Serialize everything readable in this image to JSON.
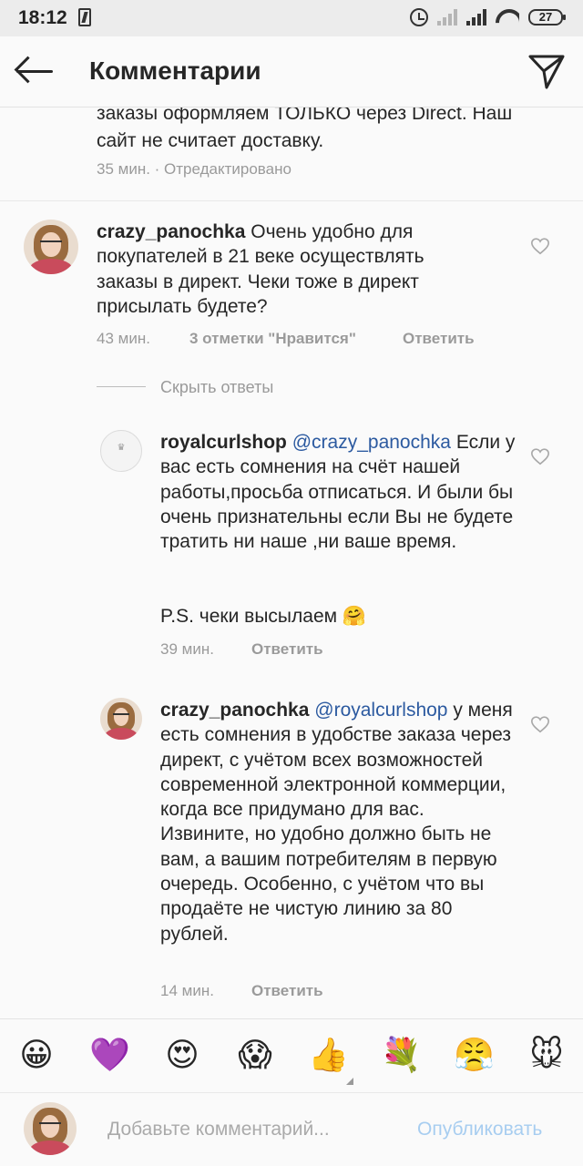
{
  "status": {
    "time": "18:12",
    "battery": "27"
  },
  "header": {
    "title": "Комментарии"
  },
  "previous": {
    "text": "заказы оформляем ТОЛЬКО через Direct. Наш сайт не считает доставку.",
    "meta": "35 мин. · Отредактировано"
  },
  "comments": [
    {
      "username": "crazy_panochka",
      "text": "Очень удобно для покупателей в 21 веке осуществлять заказы в директ. Чеки тоже в директ присылать будете?",
      "time": "43 мин.",
      "likes": "3 отметки \"Нравится\"",
      "reply_label": "Ответить"
    }
  ],
  "replies_toggle": "Скрыть ответы",
  "replies": [
    {
      "username": "royalcurlshop",
      "mention": "@crazy_panochka",
      "text": "Если у вас есть сомнения на счёт нашей работы,просьба отписаться.  И были бы очень признательны если Вы не будете тратить ни наше ,ни ваше время.",
      "ps": "P.S. чеки высылаем 🤗",
      "time": "39 мин.",
      "reply_label": "Ответить",
      "avatar_text": "ROYAL CURL SHOP"
    },
    {
      "username": "crazy_panochka",
      "mention": "@royalcurlshop",
      "text": "у меня есть сомнения в удобстве заказа через директ, с учётом всех возможностей современной электронной коммерции, когда все придумано для вас. Извините, но удобно должно быть не вам, а вашим потребителям в первую очередь. Особенно, с учётом что вы продаёте не чистую линию за 80 рублей.",
      "time": "14 мин.",
      "reply_label": "Ответить"
    }
  ],
  "emojis": [
    "😀",
    "💜",
    "😍",
    "😱",
    "👍",
    "💐",
    "😤",
    "🐭"
  ],
  "input": {
    "placeholder": "Добавьте комментарий...",
    "publish_label": "Опубликовать"
  }
}
